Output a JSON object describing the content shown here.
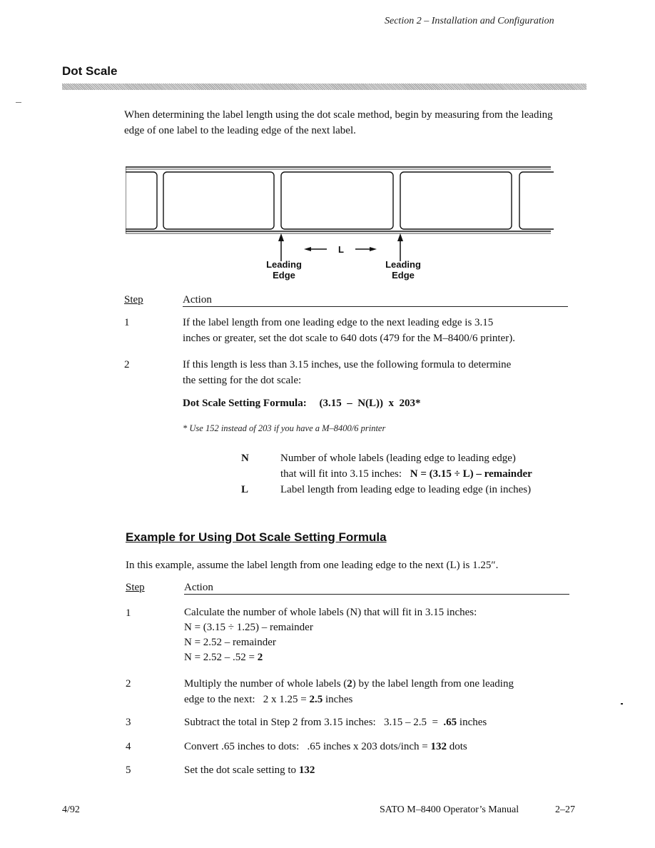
{
  "header": {
    "running_head": "Section 2 – Installation and Configuration"
  },
  "section": {
    "title": "Dot Scale",
    "intro": "When determining the label length using the dot scale method, begin by measuring from the leading edge of one label to the leading edge of the next label."
  },
  "diagram": {
    "length_label": "L",
    "leading_edge_left": [
      "Leading",
      "Edge"
    ],
    "leading_edge_right": [
      "Leading",
      "Edge"
    ]
  },
  "steps_table": {
    "step_header": "Step",
    "action_header": "Action",
    "rows": [
      {
        "num": "1",
        "lines": [
          "If the label length from one leading edge to the next leading edge is 3.15",
          "inches or greater, set the dot scale to 640 dots (479 for the M–8400/6 printer)."
        ]
      },
      {
        "num": "2",
        "lines": [
          "If this length is less than 3.15 inches, use the following formula to determine",
          "the setting for the dot scale:"
        ]
      }
    ],
    "formula_label": "Dot Scale Setting Formula:",
    "formula_expr": "(3.15  –  N(L))  x  203*",
    "footnote": "* Use 152 instead of 203 if you have a M–8400/6 printer",
    "definitions": [
      {
        "key": "N",
        "line1": "Number of whole labels (leading edge to leading edge)",
        "line2_plain": "that will fit into 3.15 inches:",
        "line2_bold": "N = (3.15 ÷ L) – remainder"
      },
      {
        "key": "L",
        "line1": "Label length from leading edge to leading edge (in inches)"
      }
    ]
  },
  "example": {
    "title": "Example for Using Dot Scale Setting Formula",
    "intro": "In this example, assume the label length from one leading edge to the next (L) is 1.25″.",
    "step_header": "Step",
    "action_header": "Action",
    "rows": [
      {
        "num": "1",
        "l1": "Calculate the number of whole labels (N) that will fit in 3.15 inches:",
        "l2": "N = (3.15 ÷ 1.25) – remainder",
        "l3": "N = 2.52 – remainder",
        "l4a": "N = 2.52 – .52 = ",
        "l4b": "2"
      },
      {
        "num": "2",
        "l1a": "Multiply the number of whole labels (",
        "l1b": "2",
        "l1c": ") by the label length from one leading",
        "l2a": "edge to the next:   2 x 1.25 = ",
        "l2b": "2.5",
        "l2c": " inches"
      },
      {
        "num": "3",
        "a": "Subtract the total in Step 2 from 3.15 inches:   3.15 – 2.5  =  ",
        "b": ".65",
        "c": " inches"
      },
      {
        "num": "4",
        "a": "Convert .65 inches to dots:   .65 inches x 203 dots/inch = ",
        "b": "132",
        "c": " dots"
      },
      {
        "num": "5",
        "a": "Set the dot scale setting to ",
        "b": "132"
      }
    ]
  },
  "footer": {
    "date": "4/92",
    "manual": "SATO M–8400 Operator’s Manual",
    "page": "2–27"
  }
}
